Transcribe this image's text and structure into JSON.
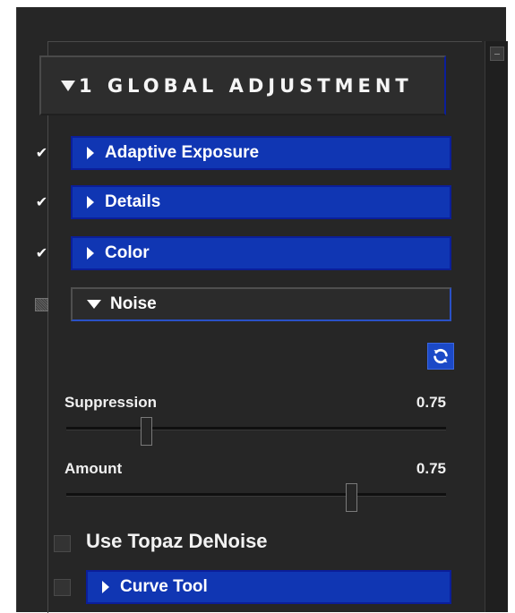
{
  "panel": {
    "global_header": {
      "title": "1 GLOBAL ADJUSTMENT"
    },
    "sections": [
      {
        "label": "Adaptive Exposure",
        "checked": true,
        "expanded": false
      },
      {
        "label": "Details",
        "checked": true,
        "expanded": false
      },
      {
        "label": "Color",
        "checked": true,
        "expanded": false
      },
      {
        "label": "Noise",
        "checked": false,
        "expanded": true
      }
    ],
    "noise": {
      "sliders": [
        {
          "label": "Suppression",
          "value": "0.75",
          "position_fraction": 0.21
        },
        {
          "label": "Amount",
          "value": "0.75",
          "position_fraction": 0.75
        }
      ],
      "denoise_option": {
        "label": "Use Topaz DeNoise",
        "checked": false
      }
    },
    "curve_tool": {
      "label": "Curve Tool",
      "checked": false,
      "expanded": false
    }
  },
  "colors": {
    "panel_background": "#262626",
    "section_blue": "#1036b3",
    "refresh_blue": "#1b49c7"
  },
  "icons": {
    "collapse_indicator": "triangle-down-icon",
    "expand_indicator": "triangle-right-icon",
    "refresh": "refresh-icon",
    "check": "checkmark-icon"
  }
}
